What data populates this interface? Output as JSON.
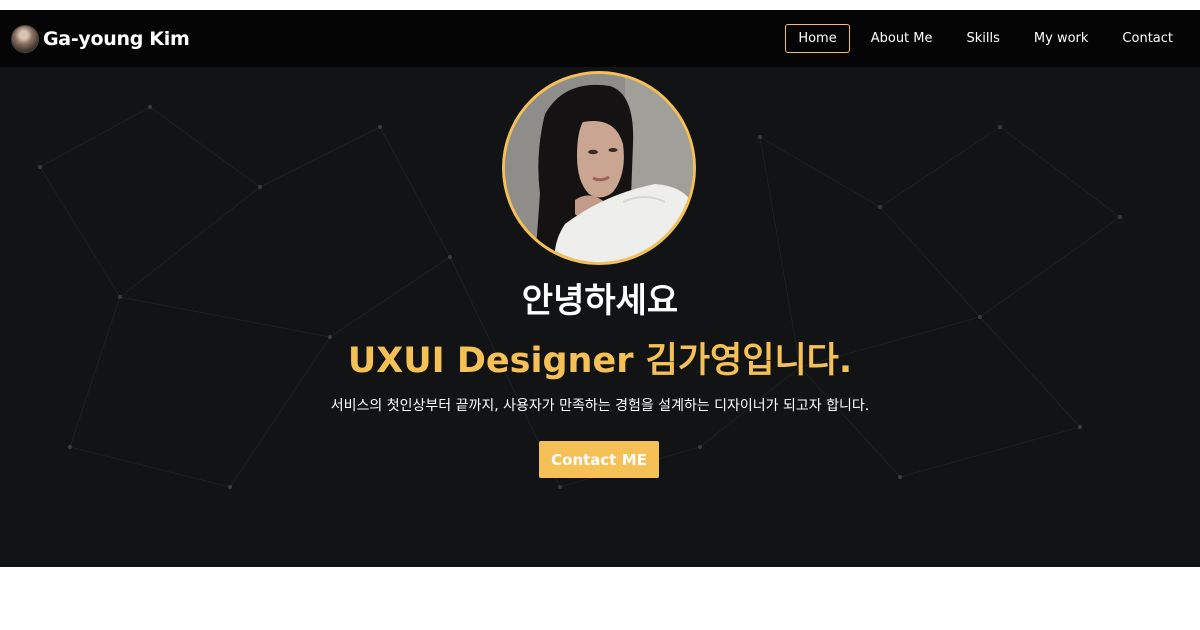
{
  "navbar": {
    "brand_name": "Ga-young Kim",
    "items": [
      {
        "label": "Home",
        "active": true
      },
      {
        "label": "About Me",
        "active": false
      },
      {
        "label": "Skills",
        "active": false
      },
      {
        "label": "My work",
        "active": false
      },
      {
        "label": "Contact",
        "active": false
      }
    ]
  },
  "hero": {
    "greeting": "안녕하세요",
    "headline": "UXUI Designer 김가영입니다.",
    "tagline": "서비스의 첫인상부터 끝까지, 사용자가 만족하는 경험을 설계하는 디자이너가 되고자 합니다.",
    "cta_label": "Contact ME"
  },
  "colors": {
    "accent": "#f5c156",
    "nav_background": "#050505",
    "hero_background": "#111314",
    "text": "#ffffff"
  }
}
